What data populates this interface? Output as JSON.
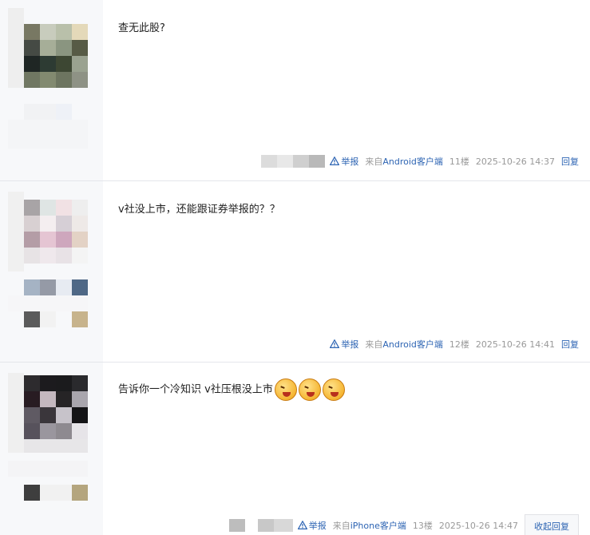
{
  "replies": [
    {
      "content": "查无此股?",
      "report": "举报",
      "from_prefix": "来自",
      "client": "Android客户端",
      "floor": "11楼",
      "time": "2025-10-26 14:37",
      "action": "回复"
    },
    {
      "content": "v社没上市，还能跟证券举报的？？",
      "report": "举报",
      "from_prefix": "来自",
      "client": "Android客户端",
      "floor": "12楼",
      "time": "2025-10-26 14:41",
      "action": "回复"
    },
    {
      "content": "告诉你一个冷知识 v社压根没上市",
      "report": "举报",
      "from_prefix": "来自",
      "client": "iPhone客户端",
      "floor": "13楼",
      "time": "2025-10-26 14:47",
      "action": "收起回复"
    }
  ],
  "icons": {
    "report": "warning-triangle-icon",
    "emoji": "laughing-emoji-icon"
  },
  "colors": {
    "link": "#2d64b3",
    "meta": "#999999",
    "sidebar": "#f7f8fa",
    "divider": "#e4e6eb"
  }
}
